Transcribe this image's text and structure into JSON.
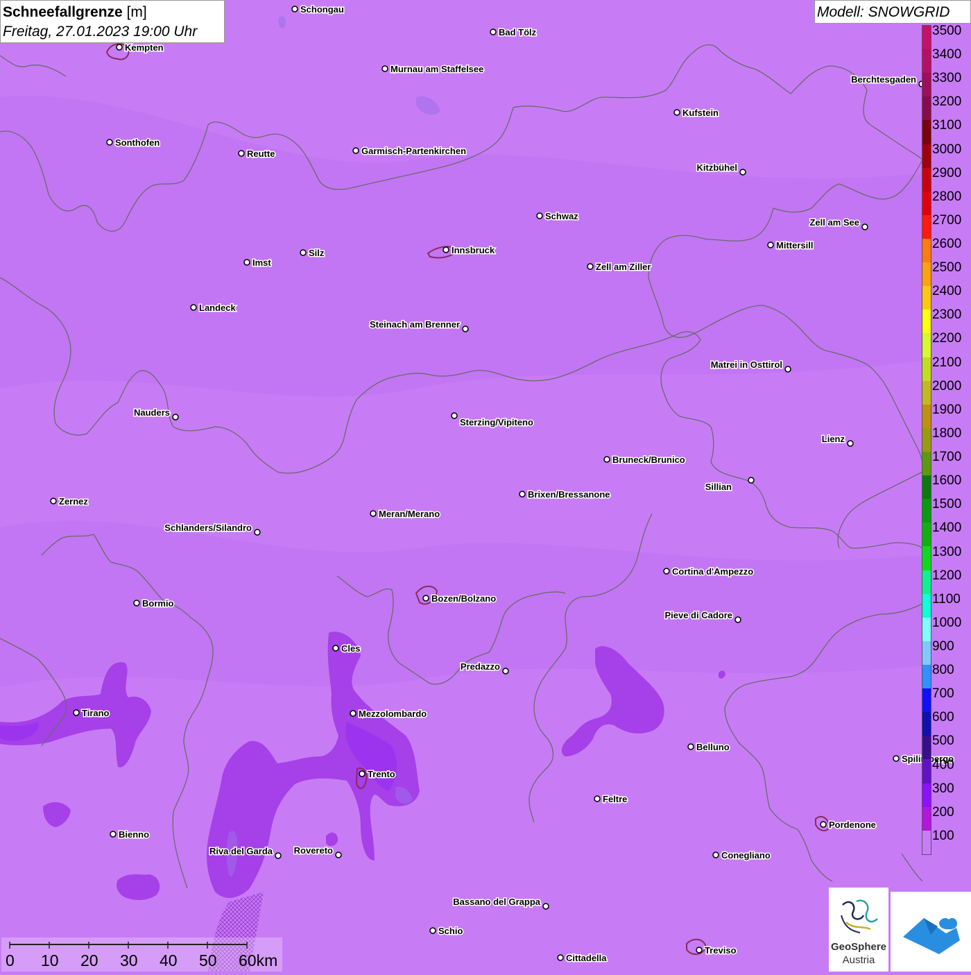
{
  "title": {
    "parameter": "Schneefallgrenze",
    "unit": "[m]",
    "datetime": "Freitag, 27.01.2023 19:00 Uhr"
  },
  "model": "Modell: SNOWGRID",
  "legend": [
    {
      "label": "3500",
      "color": "#c70f6e"
    },
    {
      "label": "3400",
      "color": "#b70e68"
    },
    {
      "label": "3300",
      "color": "#a00c5e"
    },
    {
      "label": "3200",
      "color": "#8a0a50"
    },
    {
      "label": "3100",
      "color": "#7c0010"
    },
    {
      "label": "3000",
      "color": "#a00010"
    },
    {
      "label": "2900",
      "color": "#c80012"
    },
    {
      "label": "2800",
      "color": "#e00012"
    },
    {
      "label": "2700",
      "color": "#ff1a10"
    },
    {
      "label": "2600",
      "color": "#ff7a10"
    },
    {
      "label": "2500",
      "color": "#ffa010"
    },
    {
      "label": "2400",
      "color": "#ffc810"
    },
    {
      "label": "2300",
      "color": "#ffff10"
    },
    {
      "label": "2200",
      "color": "#d8f830"
    },
    {
      "label": "2100",
      "color": "#c4dc20"
    },
    {
      "label": "2000",
      "color": "#c4b820"
    },
    {
      "label": "1900",
      "color": "#c09010"
    },
    {
      "label": "1800",
      "color": "#9c9a10"
    },
    {
      "label": "1700",
      "color": "#5c9a10"
    },
    {
      "label": "1600",
      "color": "#0a7a10"
    },
    {
      "label": "1500",
      "color": "#0a9a10"
    },
    {
      "label": "1400",
      "color": "#10b010"
    },
    {
      "label": "1300",
      "color": "#10d820"
    },
    {
      "label": "1200",
      "color": "#10f090"
    },
    {
      "label": "1100",
      "color": "#10ffd8"
    },
    {
      "label": "1000",
      "color": "#80ffff"
    },
    {
      "label": "900",
      "color": "#80c8ff"
    },
    {
      "label": "800",
      "color": "#3090ff"
    },
    {
      "label": "700",
      "color": "#1010ff"
    },
    {
      "label": "600",
      "color": "#1010b0"
    },
    {
      "label": "500",
      "color": "#3c0c8c"
    },
    {
      "label": "400",
      "color": "#6410c8"
    },
    {
      "label": "300",
      "color": "#8c10ff"
    },
    {
      "label": "200",
      "color": "#b414e0"
    },
    {
      "label": "100",
      "color": "#c87cf8"
    }
  ],
  "cities": [
    {
      "name": "Schongau"
    },
    {
      "name": "Bad Tölz"
    },
    {
      "name": "Kempten"
    },
    {
      "name": "Murnau am Staffelsee"
    },
    {
      "name": "Berchtesgaden"
    },
    {
      "name": "Kufstein"
    },
    {
      "name": "Sonthofen"
    },
    {
      "name": "Reutte"
    },
    {
      "name": "Garmisch-Partenkirchen"
    },
    {
      "name": "Kitzbühel"
    },
    {
      "name": "Schwaz"
    },
    {
      "name": "Zell am See"
    },
    {
      "name": "Innsbruck"
    },
    {
      "name": "Mittersill"
    },
    {
      "name": "Imst"
    },
    {
      "name": "Silz"
    },
    {
      "name": "Zell am Ziller"
    },
    {
      "name": "Landeck"
    },
    {
      "name": "Steinach am Brenner"
    },
    {
      "name": "Matrei in Osttirol"
    },
    {
      "name": "Nauders"
    },
    {
      "name": "Sterzing/Vipiteno"
    },
    {
      "name": "Lienz"
    },
    {
      "name": "Bruneck/Brunico"
    },
    {
      "name": "Sillian"
    },
    {
      "name": "Brixen/Bressanone"
    },
    {
      "name": "Zernez"
    },
    {
      "name": "Meran/Merano"
    },
    {
      "name": "Schlanders/Silandro"
    },
    {
      "name": "Cortina d'Ampezzo"
    },
    {
      "name": "Bozen/Bolzano"
    },
    {
      "name": "Bormio"
    },
    {
      "name": "Pieve di Cadore"
    },
    {
      "name": "Cles"
    },
    {
      "name": "Predazzo"
    },
    {
      "name": "Tirano"
    },
    {
      "name": "Mezzolombardo"
    },
    {
      "name": "Belluno"
    },
    {
      "name": "Spilimbergo"
    },
    {
      "name": "Trento"
    },
    {
      "name": "Feltre"
    },
    {
      "name": "Pordenone"
    },
    {
      "name": "Bienno"
    },
    {
      "name": "Riva del Garda"
    },
    {
      "name": "Rovereto"
    },
    {
      "name": "Conegliano"
    },
    {
      "name": "Bassano del Grappa"
    },
    {
      "name": "Schio"
    },
    {
      "name": "Treviso"
    },
    {
      "name": "Cittadella"
    }
  ],
  "scale": {
    "ticks": [
      "0",
      "10",
      "20",
      "30",
      "40",
      "50",
      "60km"
    ]
  },
  "logos": {
    "geosphere_line1": "GeoSphere",
    "geosphere_line2": "Austria",
    "geosphere_icon": "geosphere-logo-icon",
    "snowgrid_icon": "snowgrid-logo-icon"
  }
}
